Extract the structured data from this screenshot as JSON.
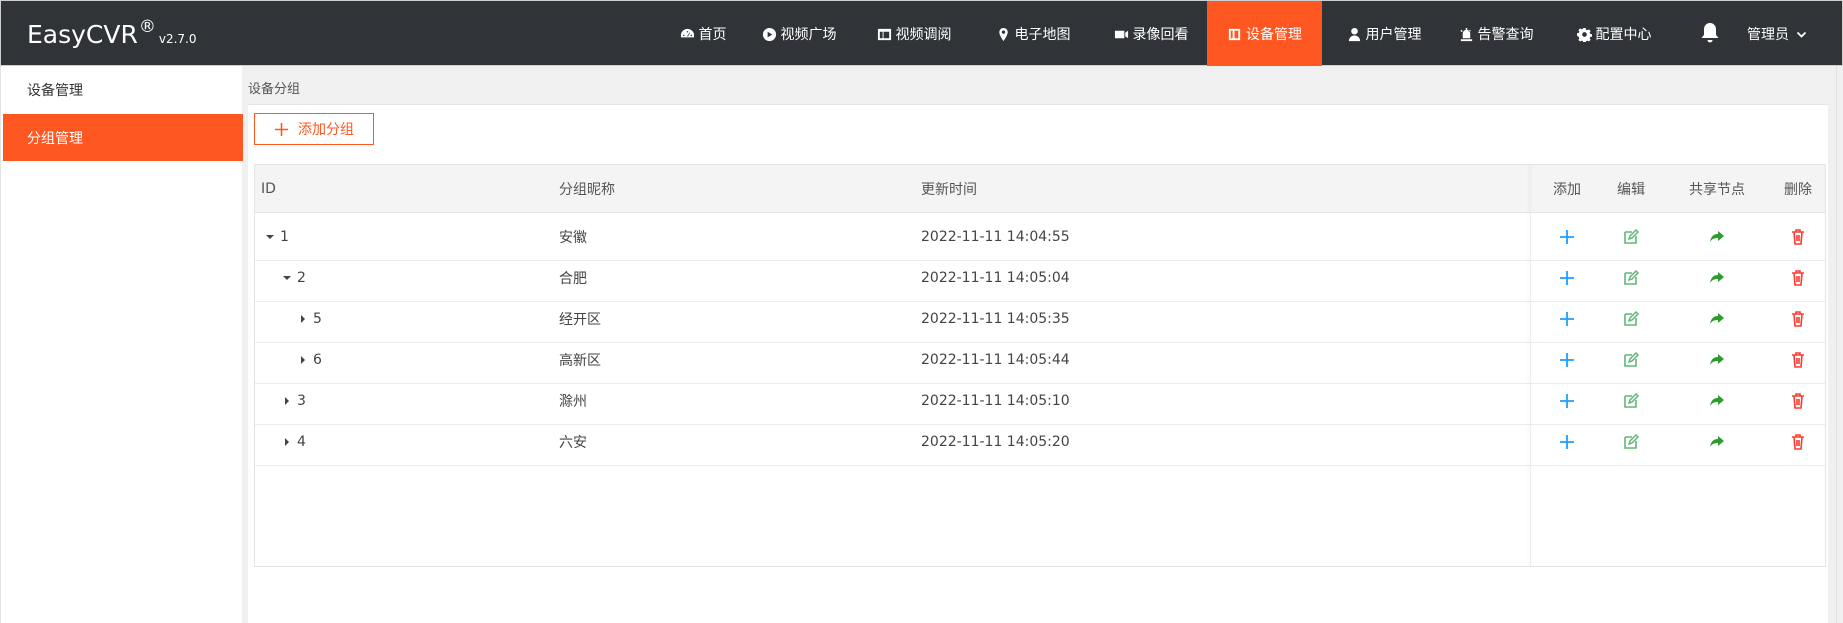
{
  "brand": {
    "name": "EasyCVR",
    "mark": "®",
    "version": "v2.7.0"
  },
  "nav": [
    {
      "label": "首页",
      "icon": "dashboard-icon"
    },
    {
      "label": "视频广场",
      "icon": "play-circle-icon"
    },
    {
      "label": "视频调阅",
      "icon": "table-icon"
    },
    {
      "label": "电子地图",
      "icon": "map-marker-icon"
    },
    {
      "label": "录像回看",
      "icon": "video-camera-icon"
    },
    {
      "label": "设备管理",
      "icon": "columns-icon",
      "active": true
    },
    {
      "label": "用户管理",
      "icon": "user-icon"
    },
    {
      "label": "告警查询",
      "icon": "alarm-icon"
    },
    {
      "label": "配置中心",
      "icon": "gear-icon"
    }
  ],
  "user": {
    "label": "管理员"
  },
  "sidebar": {
    "items": [
      {
        "label": "设备管理"
      },
      {
        "label": "分组管理",
        "active": true
      }
    ]
  },
  "breadcrumb": "设备分组",
  "toolbar": {
    "add_group_label": "添加分组"
  },
  "table": {
    "columns": [
      "ID",
      "分组昵称",
      "更新时间",
      "添加",
      "编辑",
      "共享节点",
      "删除"
    ],
    "rows": [
      {
        "id": "1",
        "name": "安徽",
        "updated": "2022-11-11 14:04:55",
        "expanded": true
      },
      {
        "id": "2",
        "name": "合肥",
        "updated": "2022-11-11 14:05:04",
        "expanded": true
      },
      {
        "id": "5",
        "name": "经开区",
        "updated": "2022-11-11 14:05:35",
        "expanded": false
      },
      {
        "id": "6",
        "name": "高新区",
        "updated": "2022-11-11 14:05:44",
        "expanded": false
      },
      {
        "id": "3",
        "name": "滁州",
        "updated": "2022-11-11 14:05:10",
        "expanded": false
      },
      {
        "id": "4",
        "name": "六安",
        "updated": "2022-11-11 14:05:20",
        "expanded": false
      }
    ]
  },
  "colors": {
    "accent": "#ff5722",
    "topbar": "#303438",
    "add": "#1e9fff",
    "edit": "#5fb878",
    "share": "#2a9d2a",
    "delete": "#ff3b30"
  }
}
